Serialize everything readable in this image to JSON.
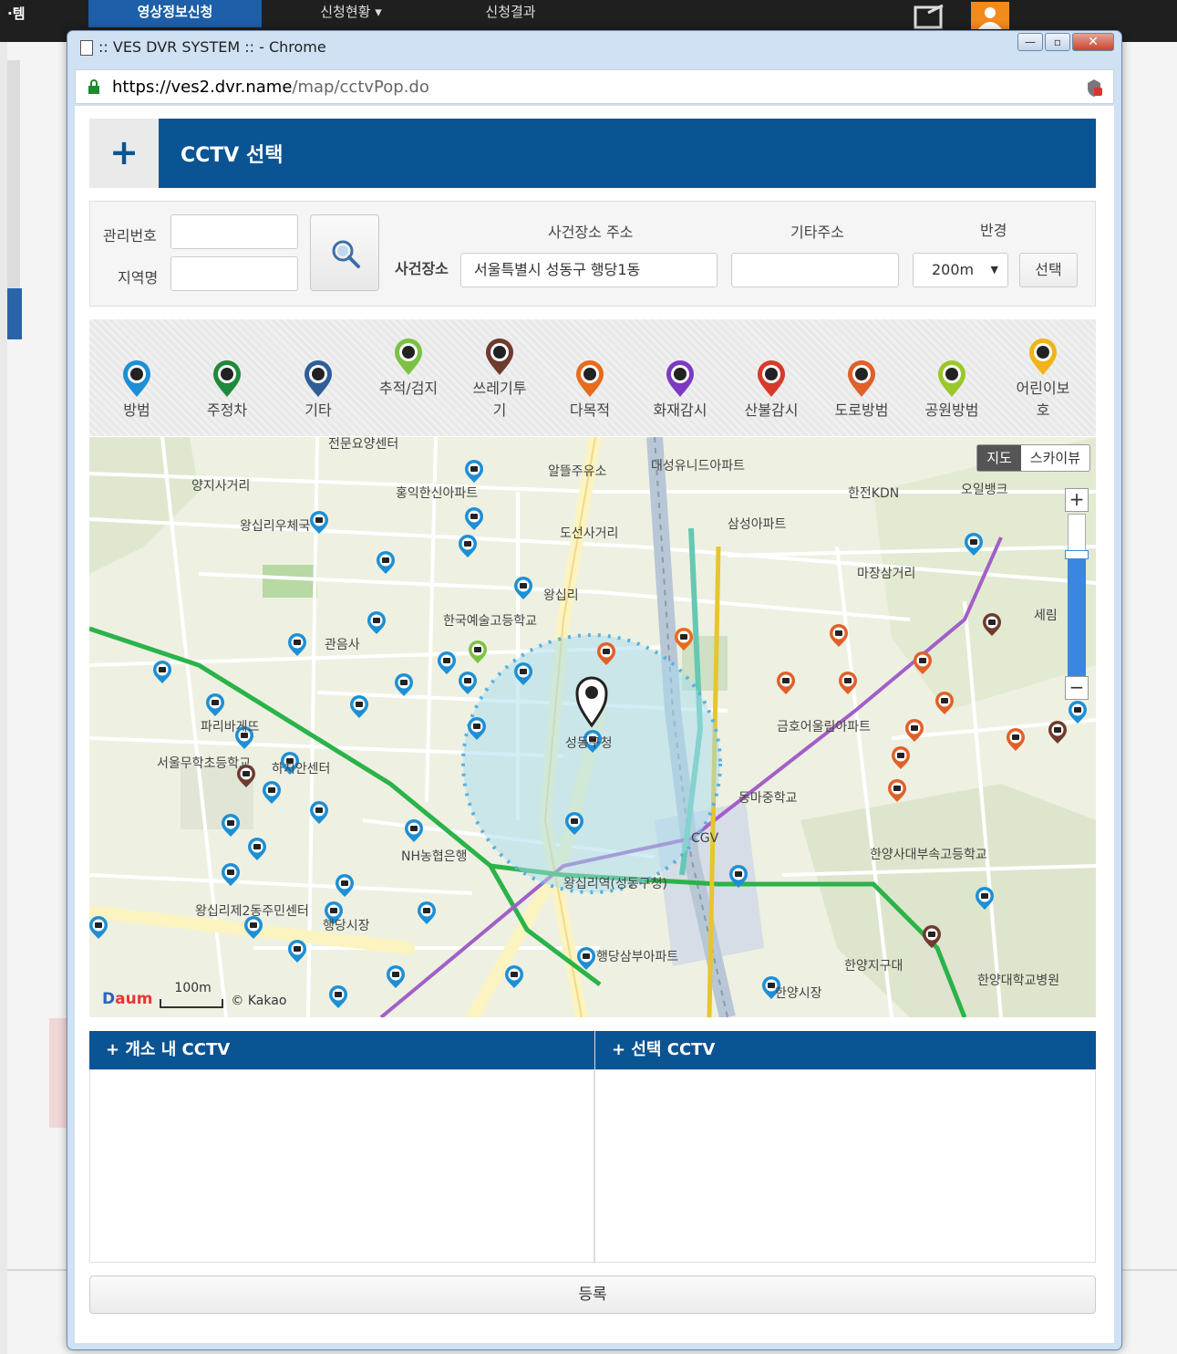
{
  "background": {
    "left_text": "·템",
    "tabs": [
      {
        "label": "영상정보신청"
      },
      {
        "label": "신청현황 ▾"
      },
      {
        "label": "신청결과"
      }
    ]
  },
  "window": {
    "title": ":: VES DVR SYSTEM :: - Chrome",
    "url_host": "https://ves2.dvr.name",
    "url_path": "/map/cctvPop.do",
    "min_label": "—",
    "max_label": "▫",
    "close_label": "✕"
  },
  "header": {
    "plus": "+",
    "title": "CCTV 선택"
  },
  "form": {
    "manage_no_label": "관리번호",
    "manage_no_value": "",
    "region_label": "지역명",
    "region_value": "",
    "incident_place_label": "사건장소",
    "incident_address_header": "사건장소 주소",
    "incident_address_value": "서울특별시 성동구 행당1동",
    "other_address_header": "기타주소",
    "other_address_value": "",
    "radius_header": "반경",
    "radius_value": "200m",
    "choose_button": "선택"
  },
  "categories": [
    {
      "name": "방범",
      "color": "#1d8fd6",
      "icon": "camera-icon"
    },
    {
      "name": "주정차",
      "color": "#1f8a3a",
      "icon": "parking-icon"
    },
    {
      "name": "기타",
      "color": "#2f5e97",
      "icon": "other-icon"
    },
    {
      "name": "추적/검지",
      "color": "#7bc144",
      "icon": "tracking-icon"
    },
    {
      "name": "쓰레기투기",
      "color": "#6e3b2e",
      "icon": "trash-icon"
    },
    {
      "name": "다목적",
      "color": "#e86a1d",
      "icon": "multipurpose-icon"
    },
    {
      "name": "화재감시",
      "color": "#7d3ac1",
      "icon": "fire-icon"
    },
    {
      "name": "산불감시",
      "color": "#d83a2a",
      "icon": "forest-fire-icon"
    },
    {
      "name": "도로방범",
      "color": "#e0602a",
      "icon": "road-camera-icon"
    },
    {
      "name": "공원방범",
      "color": "#9ac82b",
      "icon": "park-camera-icon"
    },
    {
      "name": "어린이보호",
      "color": "#f0b418",
      "icon": "child-protection-icon"
    }
  ],
  "map": {
    "toggle_map": "지도",
    "toggle_sky": "스카이뷰",
    "scale_label": "100m",
    "credit": "© Kakao",
    "logo_d": "D",
    "logo_rest": "aum",
    "labels": [
      {
        "text": "전문요양센터"
      },
      {
        "text": "양지사거리"
      },
      {
        "text": "홍익한신아파트"
      },
      {
        "text": "알뜰주유소"
      },
      {
        "text": "대성유니드아파트"
      },
      {
        "text": "한전KDN"
      },
      {
        "text": "오일뱅크"
      },
      {
        "text": "왕십리우체국"
      },
      {
        "text": "도선사거리"
      },
      {
        "text": "삼성아파트"
      },
      {
        "text": "마장삼거리"
      },
      {
        "text": "왕십리"
      },
      {
        "text": "한국예술고등학교"
      },
      {
        "text": "관음사"
      },
      {
        "text": "세림"
      },
      {
        "text": "파리바게뜨"
      },
      {
        "text": "성동구청"
      },
      {
        "text": "금호어울림아파트"
      },
      {
        "text": "서울무학초등학교"
      },
      {
        "text": "하치안센터"
      },
      {
        "text": "동마중학교"
      },
      {
        "text": "NH농협은행"
      },
      {
        "text": "왕십리역(성동구청)"
      },
      {
        "text": "한양사대부속고등학교"
      },
      {
        "text": "왕십리제2동주민센터"
      },
      {
        "text": "행당시장"
      },
      {
        "text": "행당삼부아파트"
      },
      {
        "text": "한양지구대"
      },
      {
        "text": "한양대학교병원"
      },
      {
        "text": "한양시장"
      },
      {
        "text": "CGV"
      }
    ]
  },
  "lists": {
    "in_area_title": "+ 개소 내 CCTV",
    "selected_title": "+ 선택 CCTV"
  },
  "register_button": "등록"
}
